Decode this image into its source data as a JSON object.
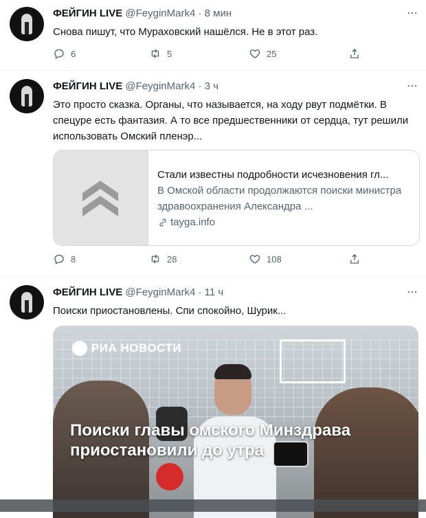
{
  "tweets": [
    {
      "author_name": "ФЕЙГИН LIVE",
      "handle": "@FeyginMark4",
      "dot": "·",
      "time": "8 мин",
      "text": "Снова пишут, что Мураховский нашёлся. Не в этот раз.",
      "replies": "6",
      "retweets": "5",
      "likes": "25"
    },
    {
      "author_name": "ФЕЙГИН LIVE",
      "handle": "@FeyginMark4",
      "dot": "·",
      "time": "3 ч",
      "text": "Это просто сказка. Органы, что называется, на ходу рвут подмётки. В спецуре есть фантазия. А то все предшественники от сердца, тут решили использовать Омский пленэр...",
      "card": {
        "title": "Стали известны подробности исчезновения гл...",
        "description": "В Омской области продолжаются поиски министра здравоохранения Александра ...",
        "domain": "tayga.info"
      },
      "replies": "8",
      "retweets": "28",
      "likes": "108"
    },
    {
      "author_name": "ФЕЙГИН LIVE",
      "handle": "@FeyginMark4",
      "dot": "·",
      "time": "11 ч",
      "text": "Поиски приостановлены. Спи спокойно, Шурик...",
      "media": {
        "logo_text": "РИА НОВОСТИ",
        "headline": "Поиски главы омского Минздрава приостановили до утра"
      }
    }
  ],
  "more_label": "···"
}
